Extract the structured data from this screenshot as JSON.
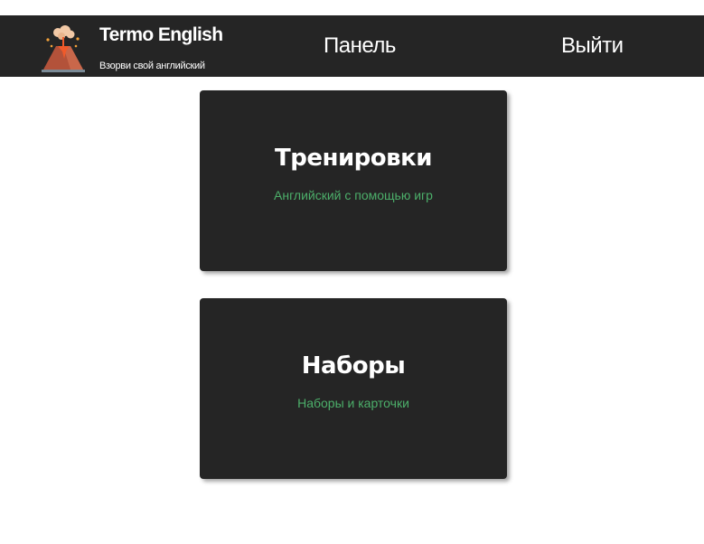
{
  "brand": {
    "title": "Termo English",
    "tagline": "Взорви свой английский",
    "logo_icon": "volcano-icon"
  },
  "nav": {
    "panel_label": "Панель",
    "logout_label": "Выйти"
  },
  "cards": [
    {
      "title": "Тренировки",
      "subtitle": "Английский с помощью игр"
    },
    {
      "title": "Наборы",
      "subtitle": "Наборы и карточки"
    }
  ],
  "colors": {
    "header_bg": "#252525",
    "card_bg": "#252525",
    "subtitle_accent": "#4caf6a",
    "page_bg": "#ffffff"
  }
}
